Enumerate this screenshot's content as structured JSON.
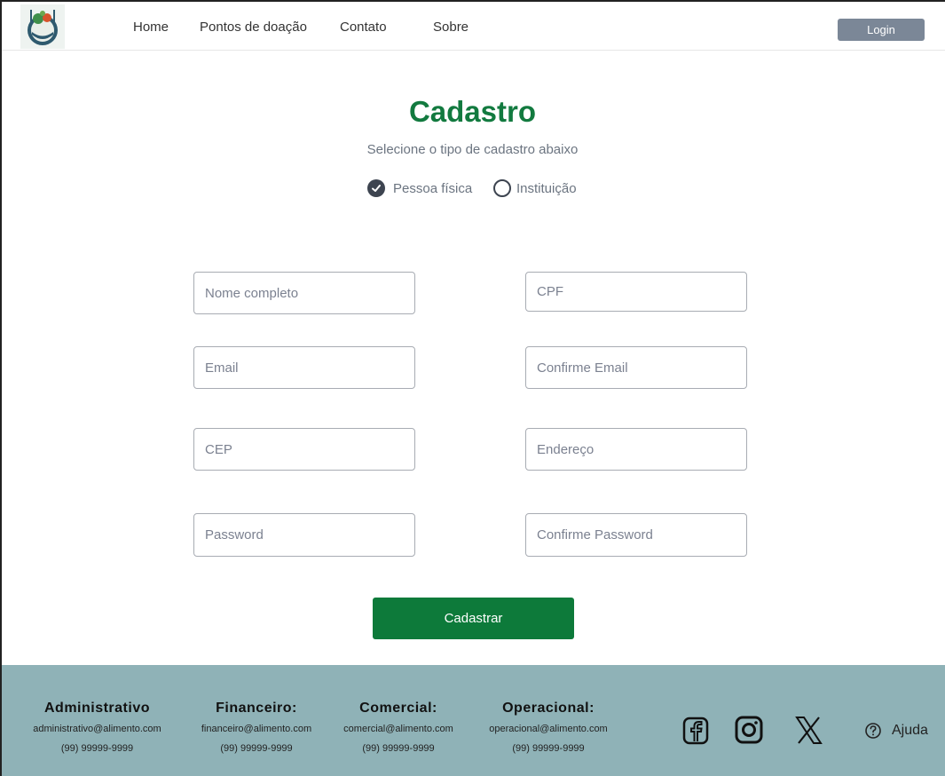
{
  "nav": {
    "home": "Home",
    "pontos": "Pontos de doação",
    "contato": "Contato",
    "sobre": "Sobre",
    "login": "Login"
  },
  "page": {
    "title": "Cadastro",
    "subtitle": "Selecione o tipo de cadastro abaixo",
    "option_pessoa": "Pessoa física",
    "option_instituicao": "Instituição",
    "selected_option": "Pessoa física"
  },
  "form": {
    "nome": "Nome completo",
    "cpf": "CPF",
    "email": "Email",
    "confirm_email": "Confirme Email",
    "cep": "CEP",
    "endereco": "Endereço",
    "password": "Password",
    "confirm_password": "Confirme Password",
    "submit": "Cadastrar"
  },
  "footer": {
    "columns": [
      {
        "title": "Administrativo",
        "email": "administrativo@alimento.com",
        "phone": "(99) 99999-9999"
      },
      {
        "title": "Financeiro:",
        "email": "financeiro@alimento.com",
        "phone": "(99) 99999-9999"
      },
      {
        "title": "Comercial:",
        "email": "comercial@alimento.com",
        "phone": "(99) 99999-9999"
      },
      {
        "title": "Operacional:",
        "email": "operacional@alimento.com",
        "phone": "(99) 99999-9999"
      }
    ],
    "social_icons": [
      "facebook-icon",
      "instagram-icon",
      "x-icon"
    ],
    "help": "Ajuda"
  },
  "colors": {
    "brand_green": "#127a3f",
    "button_green": "#0d7a3a",
    "footer_bg": "#8fb2b7",
    "login_bg": "#7b8797"
  }
}
